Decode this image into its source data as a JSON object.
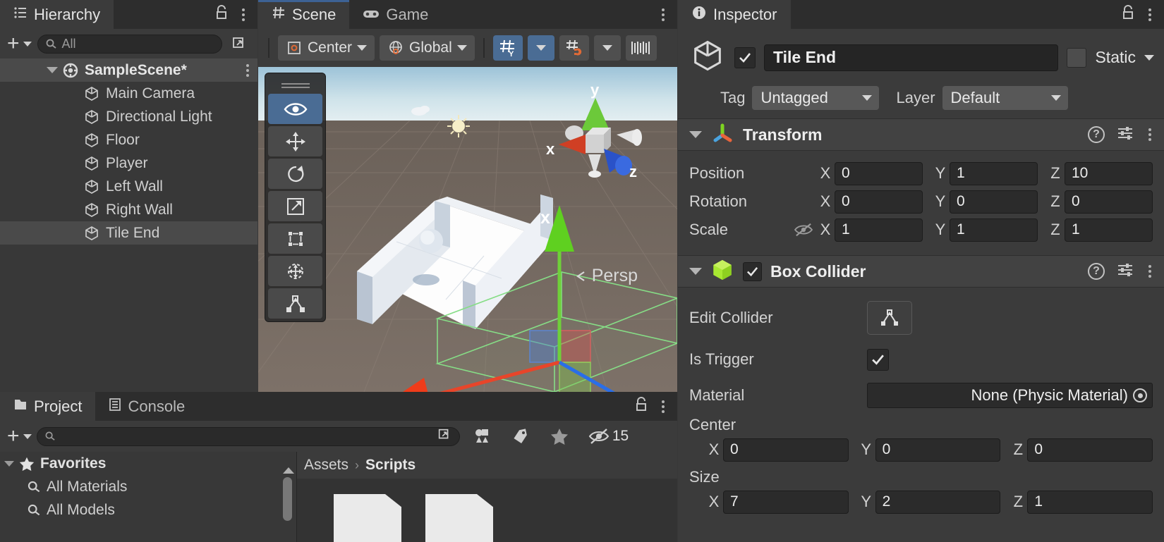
{
  "hierarchy": {
    "tab_label": "Hierarchy",
    "tab_icon": "hierarchy-icon",
    "add_label": "+",
    "search_placeholder": "All",
    "scene_name": "SampleScene*",
    "items": [
      {
        "label": "Main Camera"
      },
      {
        "label": "Directional Light"
      },
      {
        "label": "Floor"
      },
      {
        "label": "Player"
      },
      {
        "label": "Left Wall"
      },
      {
        "label": "Right Wall"
      },
      {
        "label": "Tile End"
      }
    ],
    "selected_item": "Tile End"
  },
  "scene": {
    "tabs": [
      {
        "label": "Scene",
        "icon": "grid-icon",
        "active": true
      },
      {
        "label": "Game",
        "icon": "gamepad-icon",
        "active": false
      }
    ],
    "pivot_mode": "Center",
    "handle_space": "Global",
    "grid_axis_label": "Y",
    "persp_label": "Persp",
    "gizmo_axes": {
      "x": "x",
      "y": "y",
      "z": "z"
    },
    "tools": [
      {
        "name": "view-tool",
        "active": true
      },
      {
        "name": "move-tool",
        "active": false
      },
      {
        "name": "rotate-tool",
        "active": false
      },
      {
        "name": "scale-tool",
        "active": false
      },
      {
        "name": "rect-tool",
        "active": false
      },
      {
        "name": "transform-tool",
        "active": false
      },
      {
        "name": "custom-editor-tool",
        "active": false
      }
    ]
  },
  "project": {
    "tabs": [
      {
        "label": "Project",
        "icon": "folder-icon",
        "active": true
      },
      {
        "label": "Console",
        "icon": "console-icon",
        "active": false
      }
    ],
    "add_label": "+",
    "search_placeholder": "",
    "hidden_count": "15",
    "favorites_label": "Favorites",
    "favorites": [
      {
        "label": "All Materials"
      },
      {
        "label": "All Models"
      }
    ],
    "breadcrumb": {
      "root": "Assets",
      "separator": "›",
      "current": "Scripts"
    },
    "assets": [
      {
        "name": "script-asset"
      },
      {
        "name": "script-asset"
      }
    ]
  },
  "inspector": {
    "tab_label": "Inspector",
    "tab_icon": "info-icon",
    "object_name": "Tile End",
    "object_enabled": true,
    "static_label": "Static",
    "static_checked": false,
    "tag_label": "Tag",
    "tag_value": "Untagged",
    "layer_label": "Layer",
    "layer_value": "Default",
    "transform": {
      "title": "Transform",
      "rows": [
        {
          "label": "Position",
          "x": "0",
          "y": "1",
          "z": "10"
        },
        {
          "label": "Rotation",
          "x": "0",
          "y": "0",
          "z": "0"
        },
        {
          "label": "Scale",
          "x": "1",
          "y": "1",
          "z": "1"
        }
      ],
      "axis_labels": {
        "x": "X",
        "y": "Y",
        "z": "Z"
      }
    },
    "box_collider": {
      "title": "Box Collider",
      "enabled": true,
      "edit_collider_label": "Edit Collider",
      "is_trigger_label": "Is Trigger",
      "is_trigger_checked": true,
      "material_label": "Material",
      "material_value": "None (Physic Material)",
      "center_label": "Center",
      "center": {
        "x": "0",
        "y": "0",
        "z": "0"
      },
      "size_label": "Size",
      "size": {
        "x": "7",
        "y": "2",
        "z": "1"
      },
      "axis_labels": {
        "x": "X",
        "y": "Y",
        "z": "Z"
      }
    }
  },
  "colors": {
    "accent_blue": "#4a6c94",
    "axis_x_red": "#e8442a",
    "axis_y_green": "#5ad32a",
    "axis_z_blue": "#2a6ee8",
    "collider_green": "#7ed97e"
  }
}
